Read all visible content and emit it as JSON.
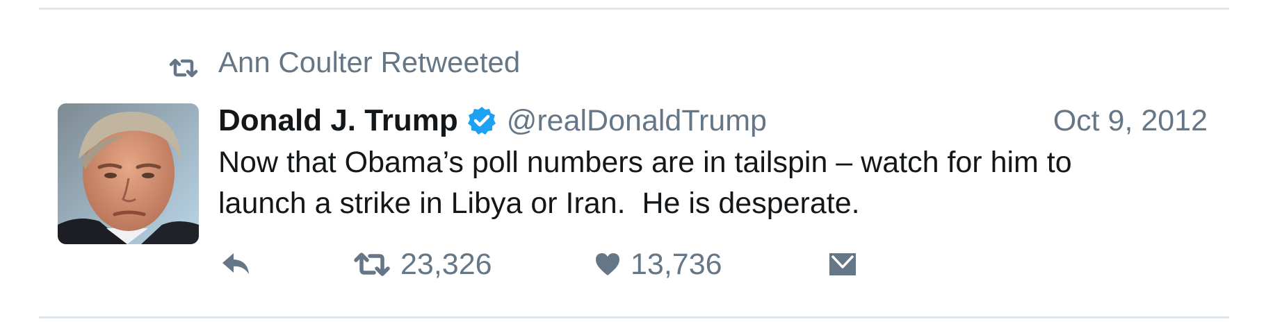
{
  "retweet_context": {
    "text": "Ann Coulter Retweeted",
    "icon": "retweet-icon"
  },
  "tweet": {
    "display_name": "Donald J. Trump",
    "verified": true,
    "handle": "@realDonaldTrump",
    "date": "Oct 9, 2012",
    "text": "Now that Obama’s poll numbers are in tailspin – watch for him to\nlaunch a strike in Libya or Iran.  He is desperate.",
    "avatar": "profile-photo"
  },
  "actions": {
    "reply_icon": "reply-icon",
    "retweet_icon": "retweet-icon",
    "retweet_count": "23,326",
    "like_icon": "heart-icon",
    "like_count": "13,736",
    "dm_icon": "envelope-icon"
  },
  "colors": {
    "text": "#14171a",
    "secondary": "#657786",
    "verified_blue": "#1da1f2",
    "divider": "#e1e8ed"
  }
}
